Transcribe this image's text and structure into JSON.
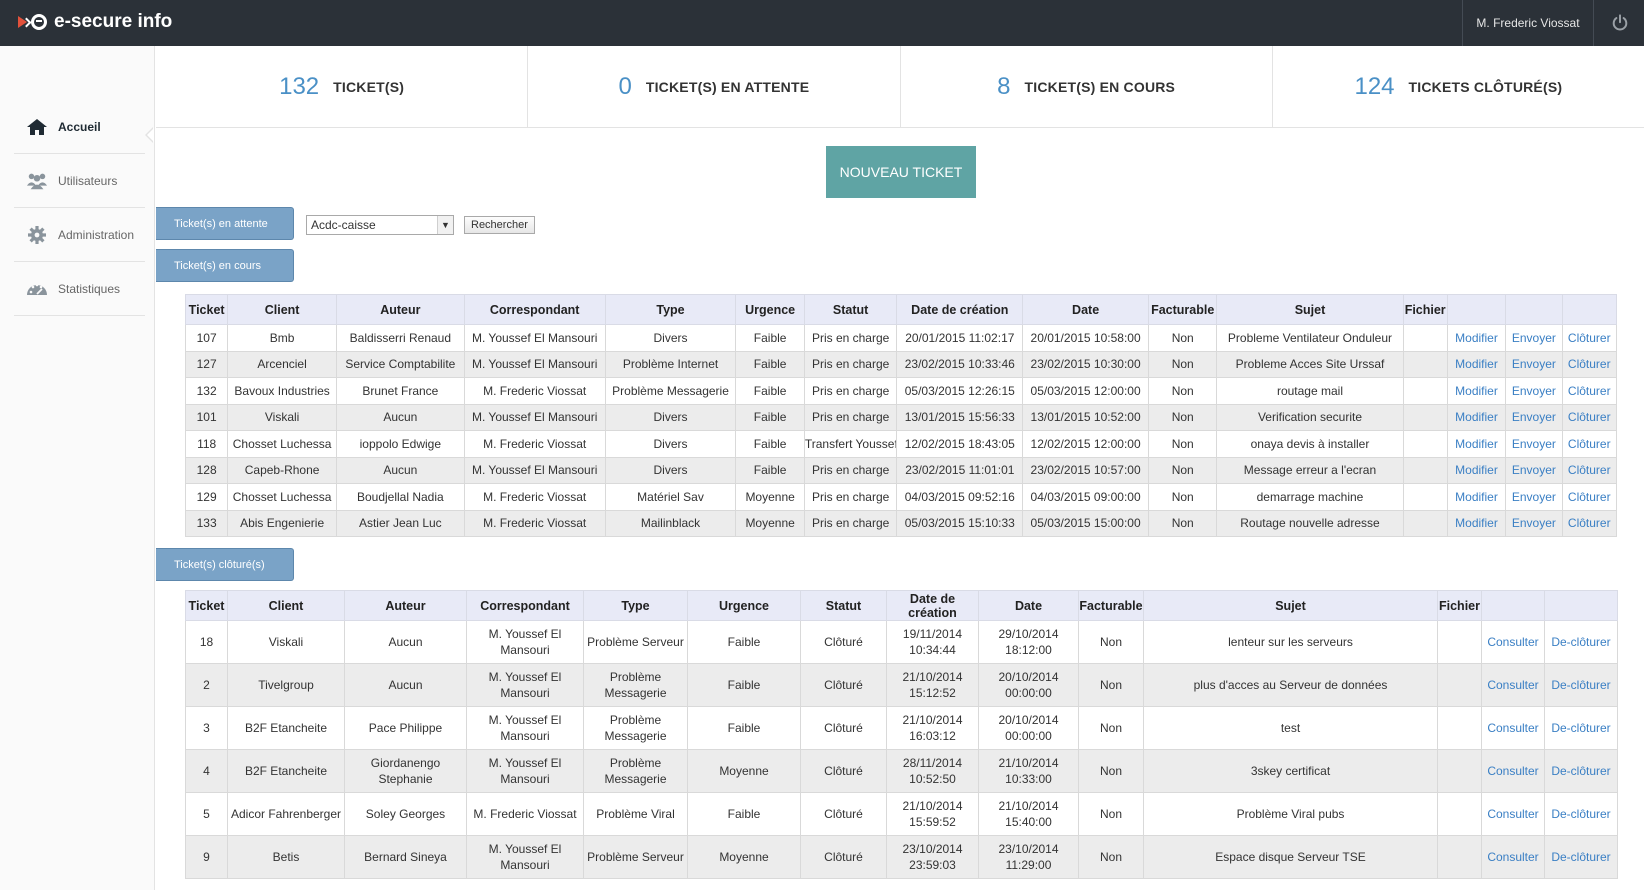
{
  "topbar": {
    "brand": "e-secure info",
    "user": "M. Frederic Viossat"
  },
  "sidebar": {
    "items": [
      {
        "label": "Accueil",
        "icon": "home-icon"
      },
      {
        "label": "Utilisateurs",
        "icon": "users-icon"
      },
      {
        "label": "Administration",
        "icon": "gear-icon"
      },
      {
        "label": "Statistiques",
        "icon": "dashboard-icon"
      }
    ]
  },
  "stats": [
    {
      "value": "132",
      "label": "TICKET(S)"
    },
    {
      "value": "0",
      "label": "TICKET(S) EN ATTENTE"
    },
    {
      "value": "8",
      "label": "TICKET(S) EN COURS"
    },
    {
      "value": "124",
      "label": "TICKETS CLÔTURÉ(S)"
    }
  ],
  "new_ticket_label": "NOUVEAU TICKET",
  "tabs": {
    "attente": "Ticket(s) en attente",
    "cours": "Ticket(s) en cours",
    "cloture": "Ticket(s) clôturé(s)"
  },
  "search": {
    "selected": "Acdc-caisse",
    "button": "Rechercher"
  },
  "open_table": {
    "headers": [
      "Ticket",
      "Client",
      "Auteur",
      "Correspondant",
      "Type",
      "Urgence",
      "Statut",
      "Date de création",
      "Date",
      "Facturable",
      "Sujet",
      "Fichier",
      "",
      "",
      ""
    ],
    "rows": [
      [
        "107",
        "Bmb",
        "Baldisserri Renaud",
        "M. Youssef El Mansouri",
        "Divers",
        "Faible",
        "Pris en charge",
        "20/01/2015 11:02:17",
        "20/01/2015 10:58:00",
        "Non",
        "Probleme Ventilateur Onduleur",
        "",
        "Modifier",
        "Envoyer",
        "Clôturer"
      ],
      [
        "127",
        "Arcenciel",
        "Service Comptabilite",
        "M. Youssef El Mansouri",
        "Problème Internet",
        "Faible",
        "Pris en charge",
        "23/02/2015 10:33:46",
        "23/02/2015 10:30:00",
        "Non",
        "Probleme Acces Site Urssaf",
        "",
        "Modifier",
        "Envoyer",
        "Clôturer"
      ],
      [
        "132",
        "Bavoux Industries",
        "Brunet France",
        "M. Frederic Viossat",
        "Problème Messagerie",
        "Faible",
        "Pris en charge",
        "05/03/2015 12:26:15",
        "05/03/2015 12:00:00",
        "Non",
        "routage mail",
        "",
        "Modifier",
        "Envoyer",
        "Clôturer"
      ],
      [
        "101",
        "Viskali",
        "Aucun",
        "M. Youssef El Mansouri",
        "Divers",
        "Faible",
        "Pris en charge",
        "13/01/2015 15:56:33",
        "13/01/2015 10:52:00",
        "Non",
        "Verification securite",
        "",
        "Modifier",
        "Envoyer",
        "Clôturer"
      ],
      [
        "118",
        "Chosset Luchessa",
        "ioppolo Edwige",
        "M. Frederic Viossat",
        "Divers",
        "Faible",
        "Transfert Youssef",
        "12/02/2015 18:43:05",
        "12/02/2015 12:00:00",
        "Non",
        "onaya devis à installer",
        "",
        "Modifier",
        "Envoyer",
        "Clôturer"
      ],
      [
        "128",
        "Capeb-Rhone",
        "Aucun",
        "M. Youssef El Mansouri",
        "Divers",
        "Faible",
        "Pris en charge",
        "23/02/2015 11:01:01",
        "23/02/2015 10:57:00",
        "Non",
        "Message erreur a l'ecran",
        "",
        "Modifier",
        "Envoyer",
        "Clôturer"
      ],
      [
        "129",
        "Chosset Luchessa",
        "Boudjellal Nadia",
        "M. Frederic Viossat",
        "Matériel Sav",
        "Moyenne",
        "Pris en charge",
        "04/03/2015 09:52:16",
        "04/03/2015 09:00:00",
        "Non",
        "demarrage machine",
        "",
        "Modifier",
        "Envoyer",
        "Clôturer"
      ],
      [
        "133",
        "Abis Engenierie",
        "Astier Jean Luc",
        "M. Frederic Viossat",
        "Mailinblack",
        "Moyenne",
        "Pris en charge",
        "05/03/2015 15:10:33",
        "05/03/2015 15:00:00",
        "Non",
        "Routage nouvelle adresse",
        "",
        "Modifier",
        "Envoyer",
        "Clôturer"
      ]
    ]
  },
  "closed_table": {
    "headers": [
      "Ticket",
      "Client",
      "Auteur",
      "Correspondant",
      "Type",
      "Urgence",
      "Statut",
      "Date de création",
      "Date",
      "Facturable",
      "Sujet",
      "Fichier",
      "",
      ""
    ],
    "rows": [
      [
        "18",
        "Viskali",
        "Aucun",
        "M. Youssef El Mansouri",
        "Problème Serveur",
        "Faible",
        "Clôturé",
        "19/11/2014 10:34:44",
        "29/10/2014 18:12:00",
        "Non",
        "lenteur sur les serveurs",
        "",
        "Consulter",
        "De-clôturer"
      ],
      [
        "2",
        "Tivelgroup",
        "Aucun",
        "M. Youssef El Mansouri",
        "Problème Messagerie",
        "Faible",
        "Clôturé",
        "21/10/2014 15:12:52",
        "20/10/2014 00:00:00",
        "Non",
        "plus d'acces au Serveur de données",
        "",
        "Consulter",
        "De-clôturer"
      ],
      [
        "3",
        "B2F Etancheite",
        "Pace Philippe",
        "M. Youssef El Mansouri",
        "Problème Messagerie",
        "Faible",
        "Clôturé",
        "21/10/2014 16:03:12",
        "20/10/2014 00:00:00",
        "Non",
        "test",
        "",
        "Consulter",
        "De-clôturer"
      ],
      [
        "4",
        "B2F Etancheite",
        "Giordanengo Stephanie",
        "M. Youssef El Mansouri",
        "Problème Messagerie",
        "Moyenne",
        "Clôturé",
        "28/11/2014 10:52:50",
        "21/10/2014 10:33:00",
        "Non",
        "3skey certificat",
        "",
        "Consulter",
        "De-clôturer"
      ],
      [
        "5",
        "Adicor Fahrenberger",
        "Soley Georges",
        "M. Frederic Viossat",
        "Problème Viral",
        "Faible",
        "Clôturé",
        "21/10/2014 15:59:52",
        "21/10/2014 15:40:00",
        "Non",
        "Problème Viral pubs",
        "",
        "Consulter",
        "De-clôturer"
      ],
      [
        "9",
        "Betis",
        "Bernard Sineya",
        "M. Youssef El Mansouri",
        "Problème Serveur",
        "Moyenne",
        "Clôturé",
        "23/10/2014 23:59:03",
        "23/10/2014 11:29:00",
        "Non",
        "Espace disque Serveur TSE",
        "",
        "Consulter",
        "De-clôturer"
      ]
    ]
  }
}
